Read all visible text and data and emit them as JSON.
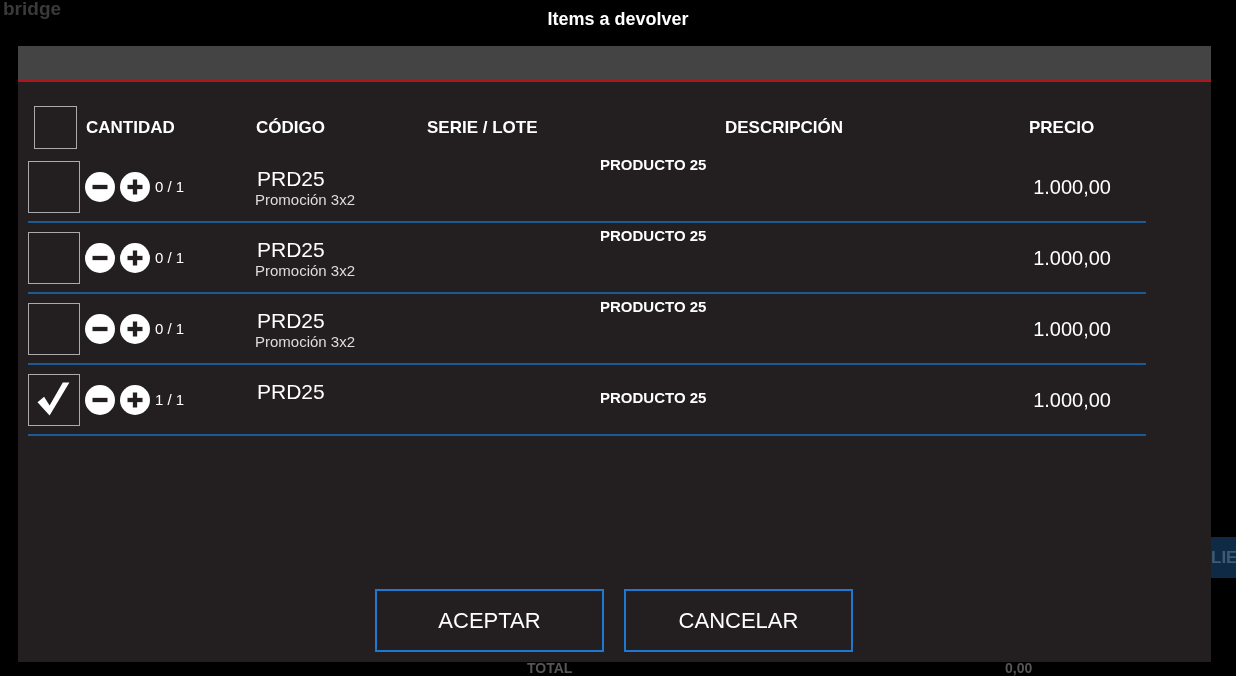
{
  "background": {
    "logo": "bridge",
    "side_button": "LIE",
    "total_label": "TOTAL",
    "total_value": "0,00"
  },
  "dialog": {
    "title": "Items a devolver",
    "select_all": {
      "checked": false
    },
    "columns": [
      "CANTIDAD",
      "CÓDIGO",
      "SERIE / LOTE",
      "DESCRIPCIÓN",
      "PRECIO"
    ],
    "rows": [
      {
        "checked": false,
        "quantity": "0 / 1",
        "code": "PRD25",
        "promotion": "Promoción 3x2",
        "description": "PRODUCTO 25",
        "price": "1.000,00"
      },
      {
        "checked": false,
        "quantity": "0 / 1",
        "code": "PRD25",
        "promotion": "Promoción 3x2",
        "description": "PRODUCTO 25",
        "price": "1.000,00"
      },
      {
        "checked": false,
        "quantity": "0 / 1",
        "code": "PRD25",
        "promotion": "Promoción 3x2",
        "description": "PRODUCTO 25",
        "price": "1.000,00"
      },
      {
        "checked": true,
        "quantity": "1 / 1",
        "code": "PRD25",
        "description": "PRODUCTO 25",
        "price": "1.000,00"
      }
    ],
    "buttons": [
      "ACEPTAR",
      "CANCELAR"
    ]
  }
}
